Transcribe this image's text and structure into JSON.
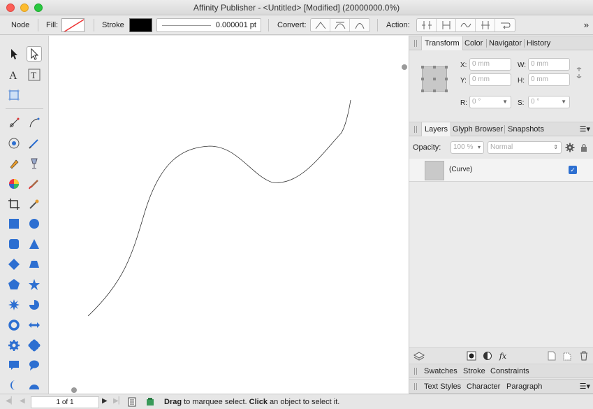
{
  "window": {
    "title": "Affinity Publisher - <Untitled> [Modified] (20000000.0%)"
  },
  "context_toolbar": {
    "tool_label": "Node",
    "fill_label": "Fill:",
    "stroke_label": "Stroke",
    "stroke_width": "0.000001 pt",
    "convert_label": "Convert:",
    "action_label": "Action:",
    "stroke_color": "#000000",
    "more_icon": "»"
  },
  "transform_panel": {
    "tabs": [
      "Transform",
      "Color",
      "Navigator",
      "History"
    ],
    "x_label": "X:",
    "x_value": "0 mm",
    "y_label": "Y:",
    "y_value": "0 mm",
    "w_label": "W:",
    "w_value": "0 mm",
    "h_label": "H:",
    "h_value": "0 mm",
    "r_label": "R:",
    "r_value": "0 °",
    "s_label": "S:",
    "s_value": "0 °"
  },
  "layers_panel": {
    "tabs": [
      "Layers",
      "Glyph Browser",
      "Snapshots"
    ],
    "opacity_label": "Opacity:",
    "opacity_value": "100 %",
    "blend_mode": "Normal",
    "layers": [
      {
        "name": "(Curve)",
        "visible": true
      }
    ]
  },
  "swatches_bar": {
    "tabs": [
      "Swatches",
      "Stroke",
      "Constraints"
    ]
  },
  "text_bar": {
    "tabs": [
      "Text Styles",
      "Character",
      "Paragraph"
    ]
  },
  "status": {
    "page": "1 of 1",
    "drag_word": "Drag",
    "drag_text": " to marquee select. ",
    "click_word": "Click",
    "click_text": " an object to select it."
  },
  "colors": {
    "accent": "#2d6fd1",
    "canvas": "#ffffff",
    "panel": "#e8e8e8"
  }
}
